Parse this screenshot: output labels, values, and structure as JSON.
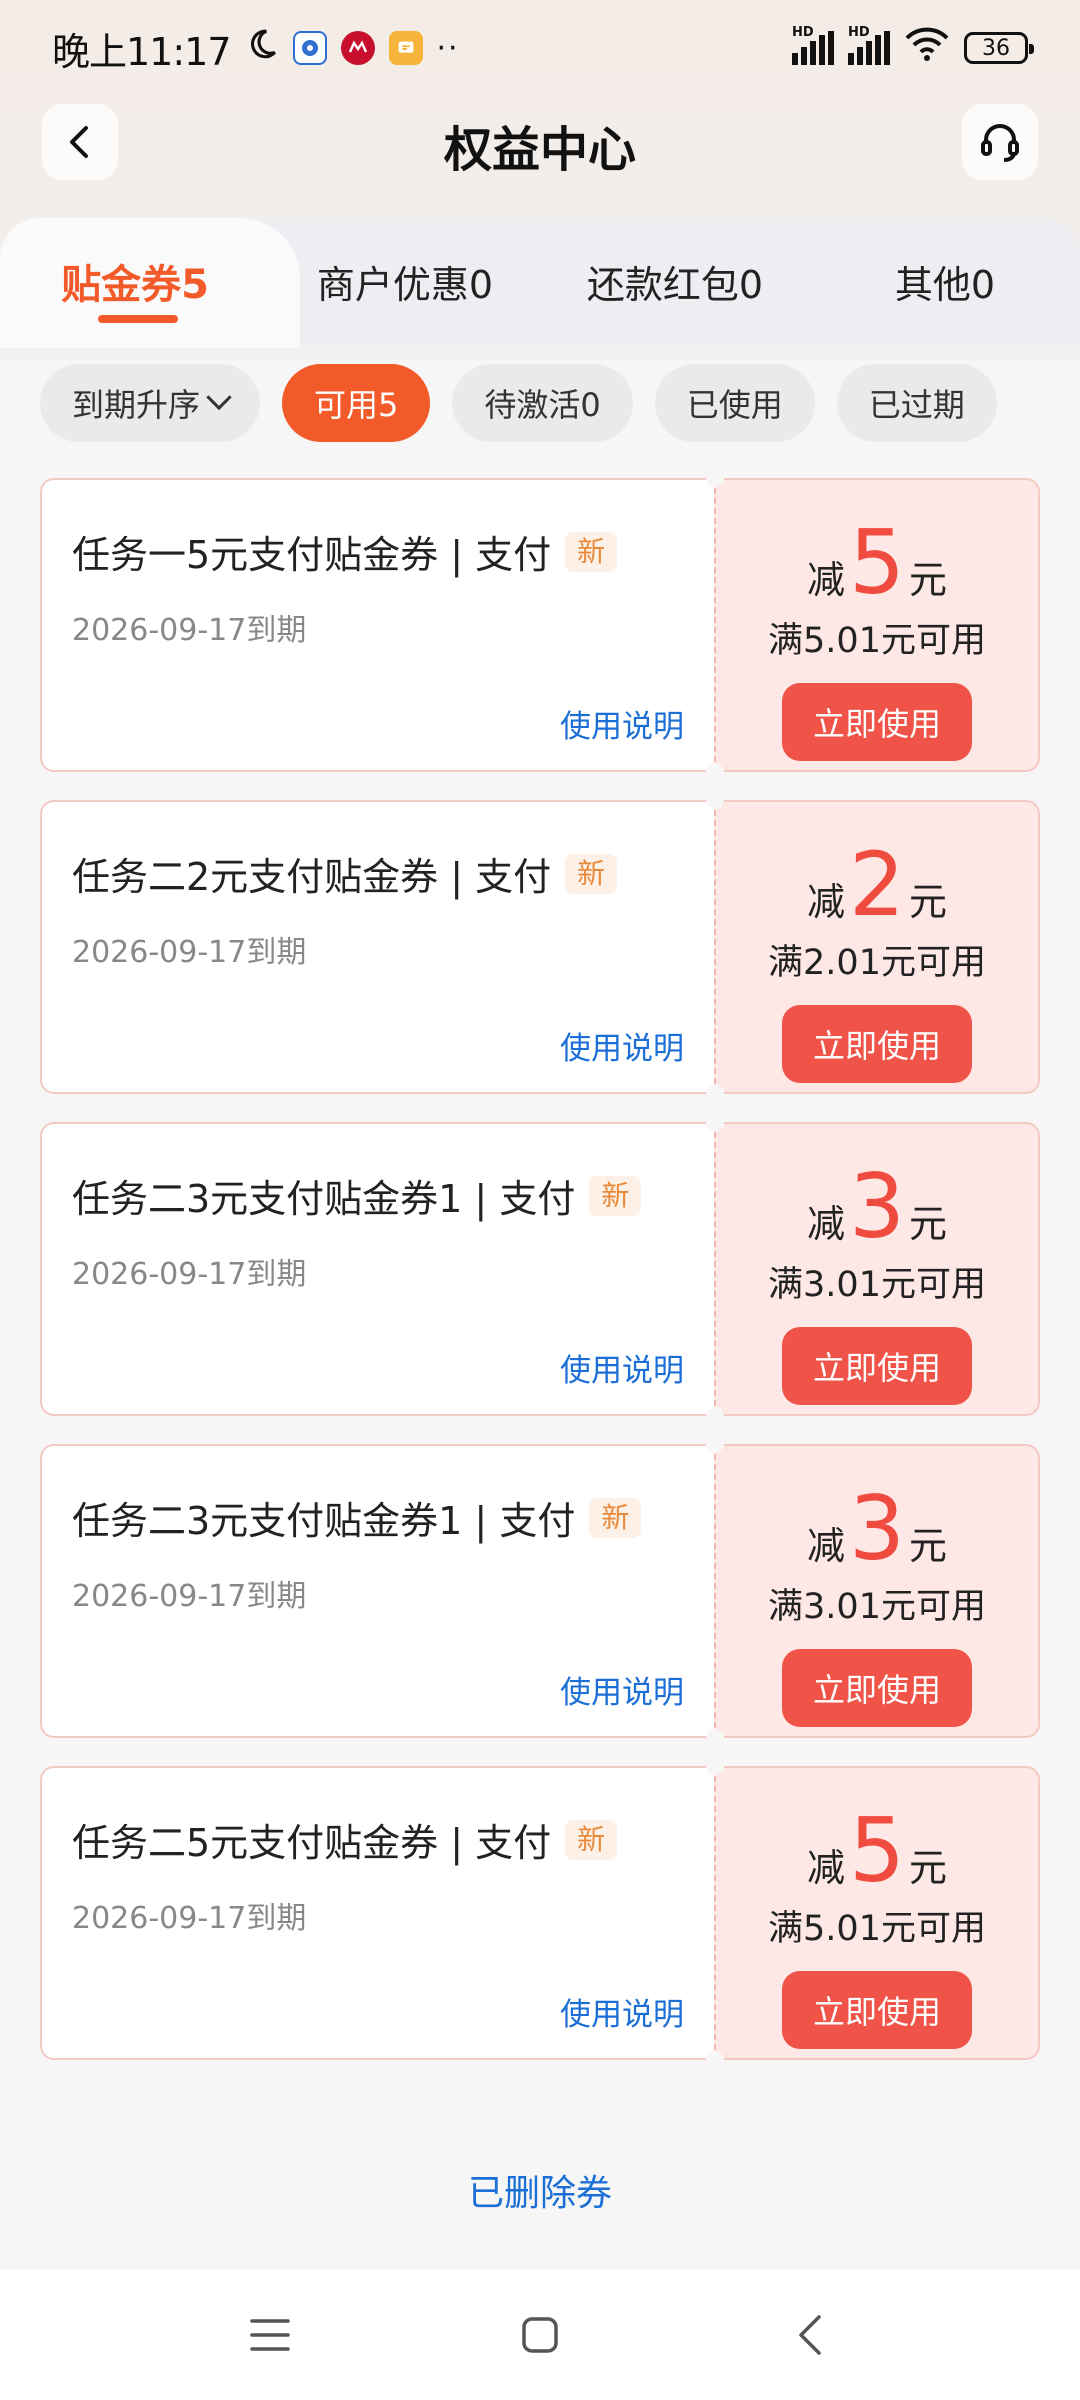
{
  "status_bar": {
    "time": "晚上11:17",
    "battery": "36",
    "signal1_label": "HD",
    "signal2_label": "HD"
  },
  "header": {
    "title": "权益中心"
  },
  "tabs": [
    {
      "label": "贴金券5",
      "active": true
    },
    {
      "label": "商户优惠0",
      "active": false
    },
    {
      "label": "还款红包0",
      "active": false
    },
    {
      "label": "其他0",
      "active": false
    }
  ],
  "filters": [
    {
      "label": "到期升序",
      "active": false
    },
    {
      "label": "可用5",
      "active": true
    },
    {
      "label": "待激活0",
      "active": false
    },
    {
      "label": "已使用",
      "active": false
    },
    {
      "label": "已过期",
      "active": false
    }
  ],
  "coupons": [
    {
      "title": "任务一5元支付贴金券 | 支付",
      "badge": "新",
      "date": "2026-09-17到期",
      "usage": "使用说明",
      "pre": "减",
      "amount": "5",
      "unit": "元",
      "condition": "满5.01元可用",
      "button": "立即使用"
    },
    {
      "title": "任务二2元支付贴金券 | 支付",
      "badge": "新",
      "date": "2026-09-17到期",
      "usage": "使用说明",
      "pre": "减",
      "amount": "2",
      "unit": "元",
      "condition": "满2.01元可用",
      "button": "立即使用"
    },
    {
      "title": "任务二3元支付贴金券1 | 支付",
      "badge": "新",
      "date": "2026-09-17到期",
      "usage": "使用说明",
      "pre": "减",
      "amount": "3",
      "unit": "元",
      "condition": "满3.01元可用",
      "button": "立即使用"
    },
    {
      "title": "任务二3元支付贴金券1 | 支付",
      "badge": "新",
      "date": "2026-09-17到期",
      "usage": "使用说明",
      "pre": "减",
      "amount": "3",
      "unit": "元",
      "condition": "满3.01元可用",
      "button": "立即使用"
    },
    {
      "title": "任务二5元支付贴金券 | 支付",
      "badge": "新",
      "date": "2026-09-17到期",
      "usage": "使用说明",
      "pre": "减",
      "amount": "5",
      "unit": "元",
      "condition": "满5.01元可用",
      "button": "立即使用"
    }
  ],
  "footer": {
    "deleted_label": "已删除券"
  },
  "colors": {
    "accent": "#f25a2a",
    "amount": "#f04b3f",
    "link": "#1b6fd6"
  }
}
